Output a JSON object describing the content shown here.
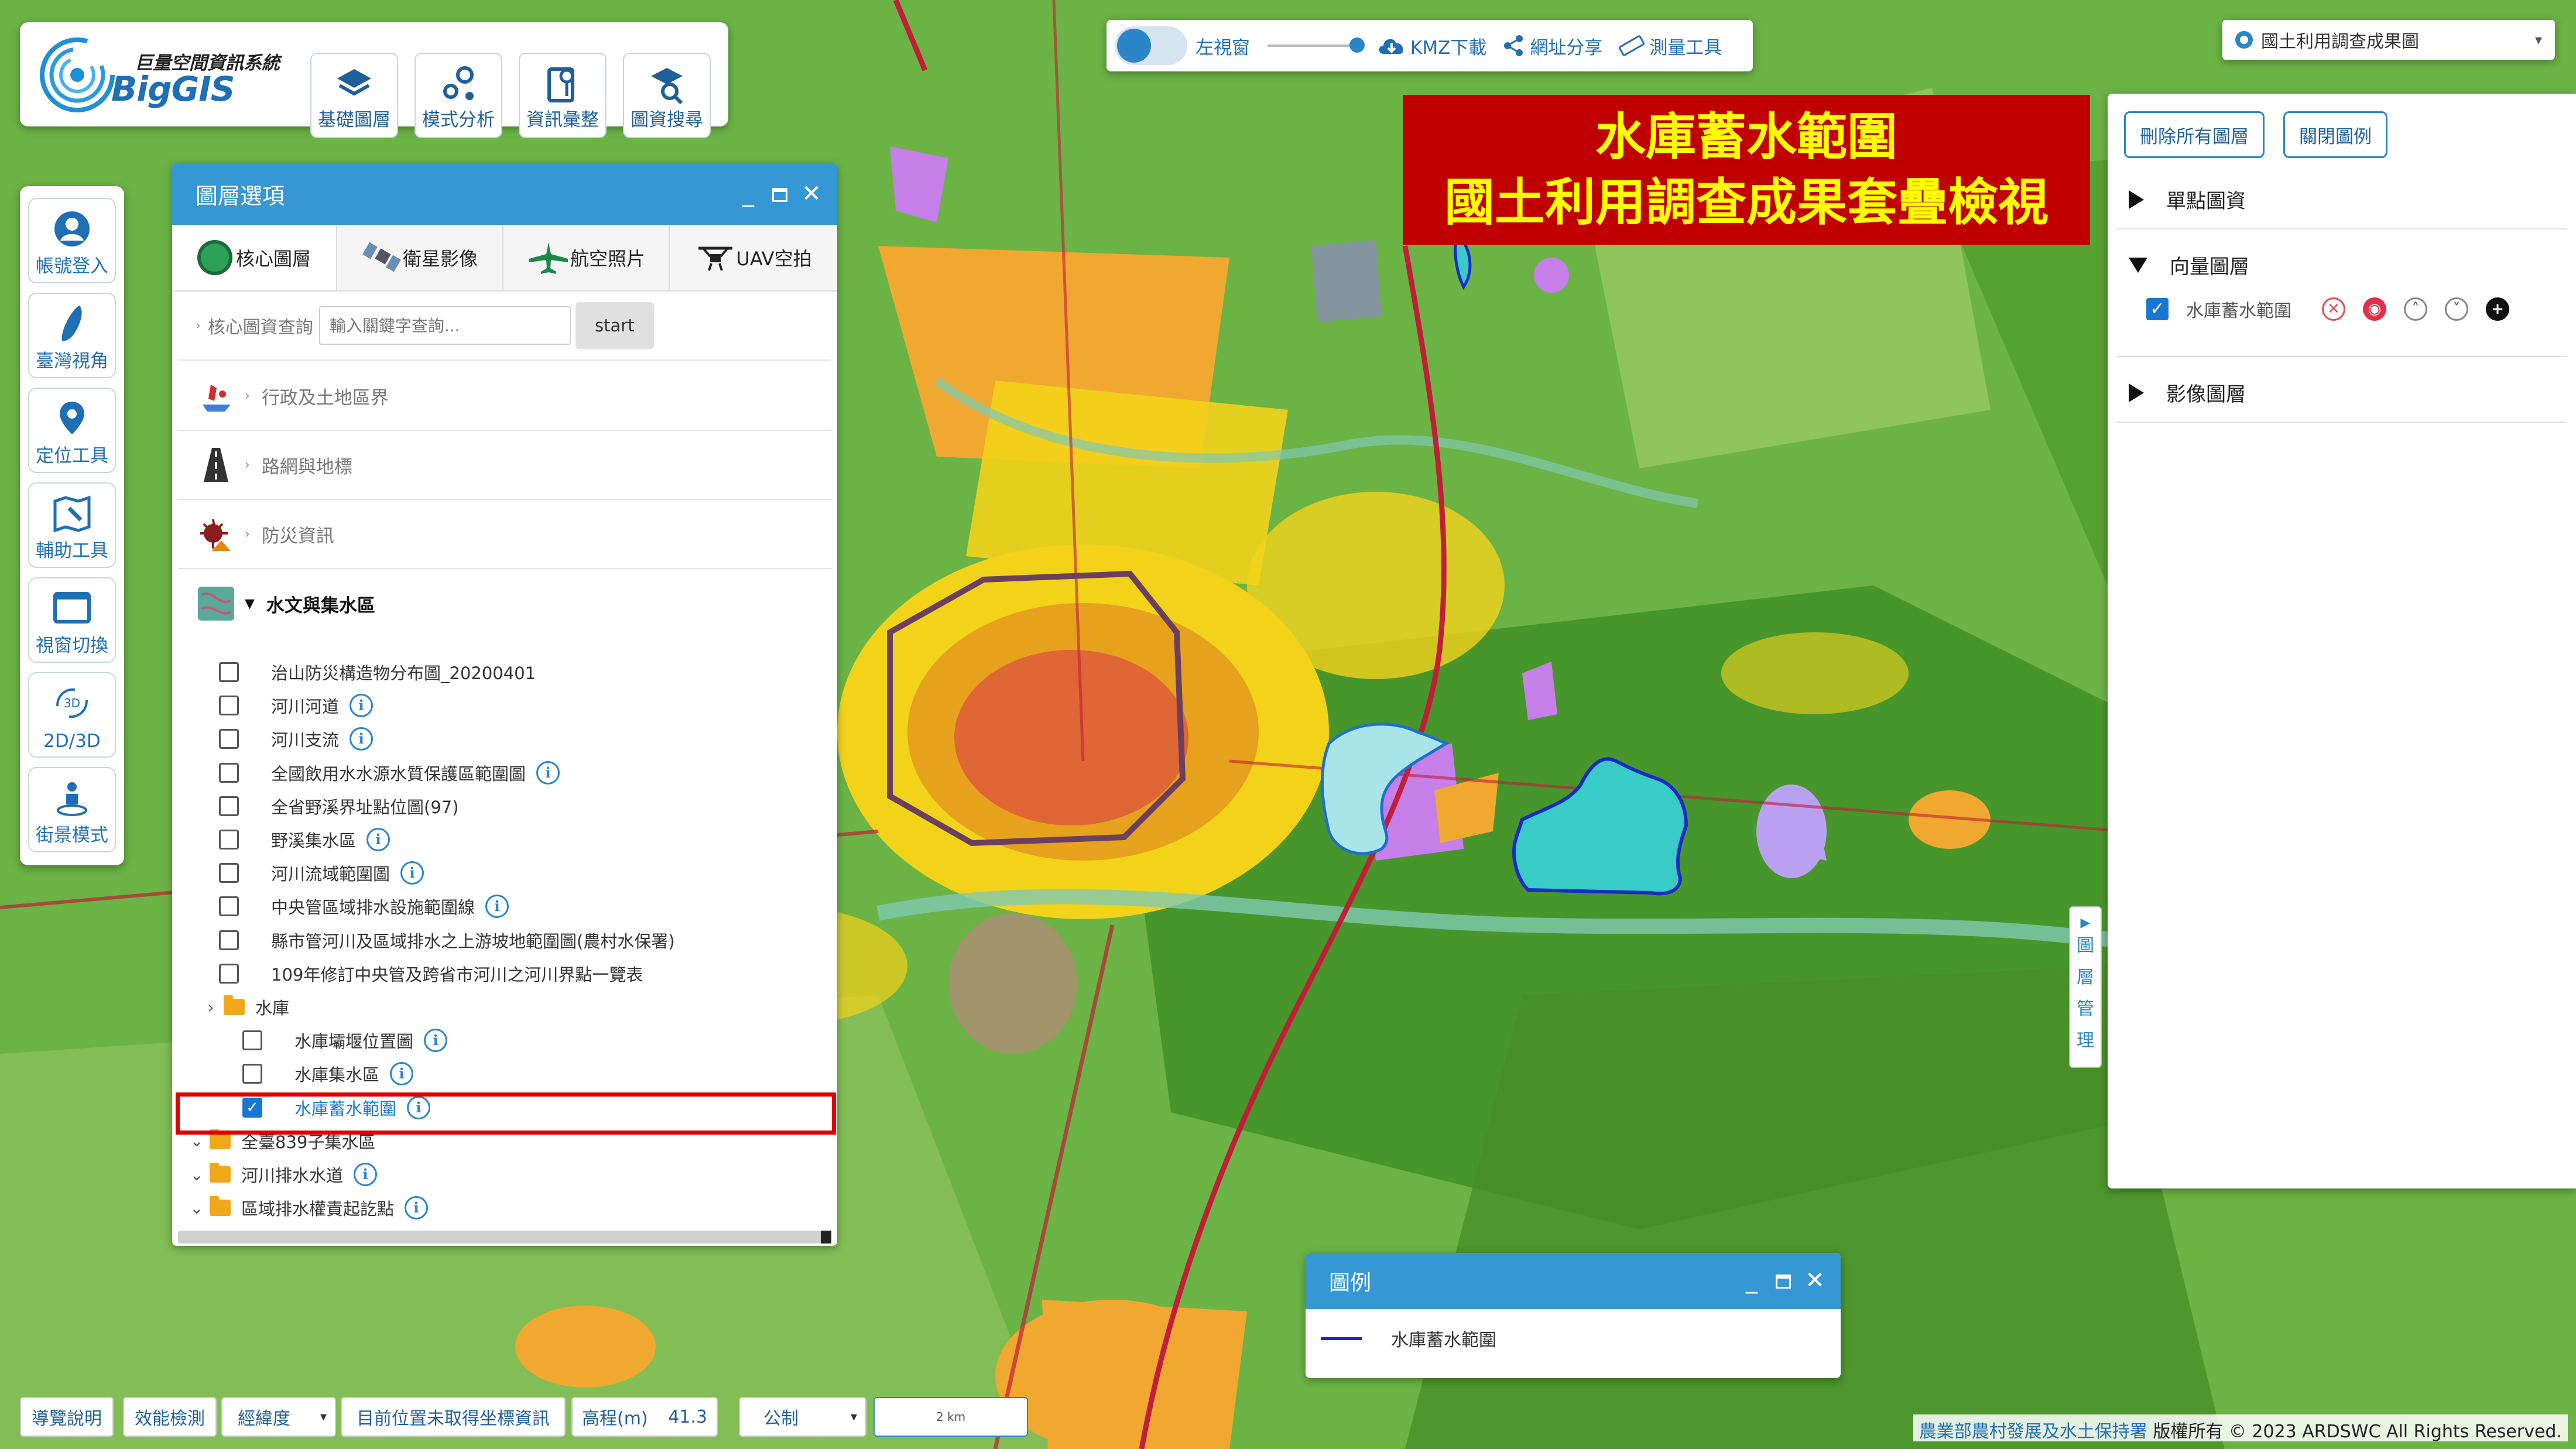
{
  "app": {
    "logo_sub": "巨量空間資訊系統",
    "logo_main": "BigGIS"
  },
  "toolbar": [
    "基礎圖層",
    "模式分析",
    "資訊彙整",
    "圖資搜尋"
  ],
  "sidebar": [
    "帳號登入",
    "臺灣視角",
    "定位工具",
    "輔助工具",
    "視窗切換",
    "2D/3D",
    "街景模式"
  ],
  "top_controls": {
    "left_window": "左視窗",
    "kmz": "KMZ下載",
    "share": "網址分享",
    "measure": "測量工具"
  },
  "basemap_select": "國土利用調查成果圖",
  "title_banner": {
    "line1": "水庫蓄水範圍",
    "line2": "國土利用調查成果套疊檢視"
  },
  "layer_panel": {
    "title": "圖層選項",
    "tabs": [
      "核心圖層",
      "衛星影像",
      "航空照片",
      "UAV空拍"
    ],
    "search": {
      "label": "核心圖資查詢",
      "placeholder": "輸入關鍵字查詢...",
      "button": "start"
    },
    "categories": [
      "行政及土地區界",
      "路網與地標",
      "防災資訊",
      "水文與集水區"
    ],
    "layers": [
      {
        "label": "治山防災構造物分布圖_20200401",
        "info": false,
        "checked": false
      },
      {
        "label": "河川河道",
        "info": true,
        "checked": false
      },
      {
        "label": "河川支流",
        "info": true,
        "checked": false
      },
      {
        "label": "全國飲用水水源水質保護區範圍圖",
        "info": true,
        "checked": false
      },
      {
        "label": "全省野溪界址點位圖(97)",
        "info": false,
        "checked": false
      },
      {
        "label": "野溪集水區",
        "info": true,
        "checked": false
      },
      {
        "label": "河川流域範圍圖",
        "info": true,
        "checked": false
      },
      {
        "label": "中央管區域排水設施範圍線",
        "info": true,
        "checked": false
      },
      {
        "label": "縣市管河川及區域排水之上游坡地範圍圖(農村水保署)",
        "info": false,
        "checked": false
      },
      {
        "label": "109年修訂中央管及跨省市河川之河川界點一覽表",
        "info": false,
        "checked": false
      }
    ],
    "reservoir_folder": "水庫",
    "reservoir_layers": [
      {
        "label": "水庫壩堰位置圖",
        "checked": false
      },
      {
        "label": "水庫集水區",
        "checked": false
      },
      {
        "label": "水庫蓄水範圍",
        "checked": true
      }
    ],
    "folders_after": [
      "全臺839子集水區",
      "河川排水水道",
      "區域排水權責起訖點"
    ]
  },
  "right_panel": {
    "remove_all": "刪除所有圖層",
    "close_legend": "關閉圖例",
    "sections": [
      "單點圖資",
      "向量圖層",
      "影像圖層"
    ],
    "active_layer": "水庫蓄水範圍"
  },
  "layer_mgr_tab": "圖層管理",
  "legend": {
    "title": "圖例",
    "item": "水庫蓄水範圍",
    "line_color": "#1a2bc4"
  },
  "bottom_bar": {
    "guide": "導覽說明",
    "perf": "效能檢測",
    "coord_sel": "經緯度",
    "coord_text": "目前位置未取得坐標資訊",
    "elev_label": "高程(m)",
    "elev_value": "41.3",
    "unit_sel": "公制",
    "scale": "2 km"
  },
  "footer": {
    "agency": "農業部農村發展及水土保持署",
    "copyright": "版權所有 © 2023 ARDSWC All Rights Reserved."
  },
  "colors": {
    "accent": "#3597d3",
    "banner_bg": "#c00000",
    "banner_text": "#ffff00",
    "highlight_box": "#e00000"
  }
}
